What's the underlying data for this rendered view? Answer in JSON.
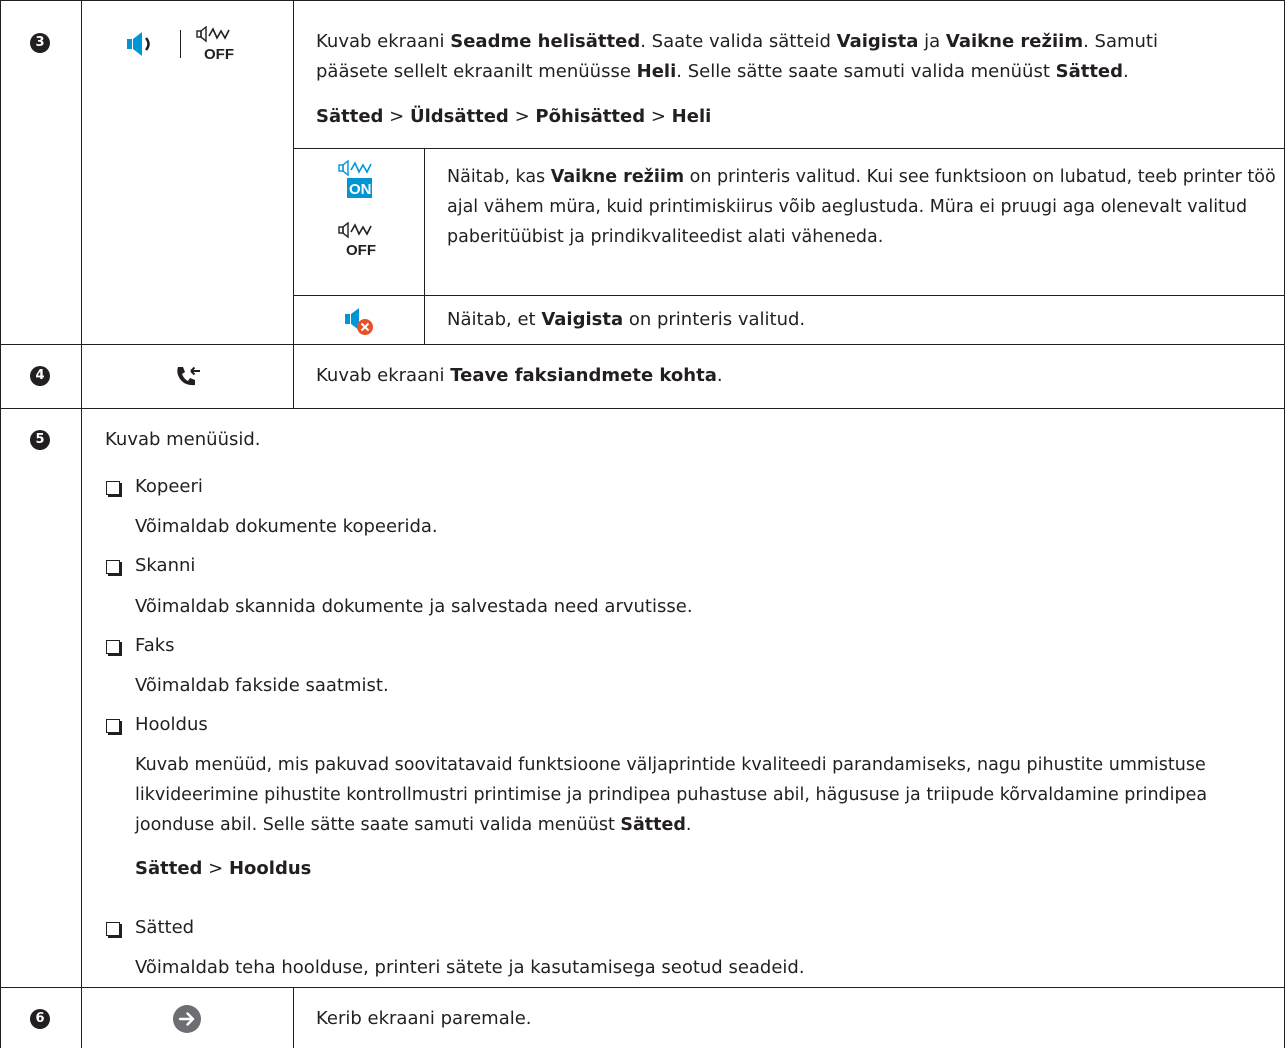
{
  "row3": {
    "num": "3",
    "desc_p1": "Kuvab ekraani ",
    "desc_b1": "Seadme helisätted",
    "desc_p2": ". Saate valida sätteid ",
    "desc_b2": "Vaigista",
    "desc_p3": " ja ",
    "desc_b3": "Vaikne režiim",
    "desc_p4": ". Samuti",
    "desc_l2_p1": "pääsete sellelt ekraanilt menüüsse ",
    "desc_l2_b1": "Heli",
    "desc_l2_p2": ". Selle sätte saate samuti valida menüüst ",
    "desc_l2_b2": "Sätted",
    "desc_l2_p3": ".",
    "path": [
      "Sätted",
      "Üldsätted",
      "Põhisätted",
      "Heli"
    ],
    "path_sep": ">",
    "sub1": {
      "p1": "Näitab, kas ",
      "b1": "Vaikne režiim",
      "p2": " on printeris valitud. Kui see funktsioon on lubatud, teeb printer töö ajal vähem müra, kuid printimiskiirus võib aeglustuda. Müra ei pruugi aga olenevalt valitud paberitüübist ja prindikvaliteedist alati väheneda.",
      "icon_on": "ON",
      "icon_off": "OFF"
    },
    "sub2": {
      "p1": "Näitab, et ",
      "b1": "Vaigista",
      "p2": " on printeris valitud."
    },
    "icon_off_label": "OFF"
  },
  "row4": {
    "num": "4",
    "p1": "Kuvab ekraani ",
    "b1": "Teave faksiandmete kohta",
    "p2": "."
  },
  "row5": {
    "num": "5",
    "intro": "Kuvab menüüsid.",
    "items": [
      {
        "label": "Kopeeri",
        "desc": "Võimaldab dokumente kopeerida."
      },
      {
        "label": "Skanni",
        "desc": "Võimaldab skannida dokumente ja salvestada need arvutisse."
      },
      {
        "label": "Faks",
        "desc": "Võimaldab fakside saatmist."
      },
      {
        "label": "Hooldus",
        "desc": "Kuvab menüüd, mis pakuvad soovitatavaid funktsioone väljaprintide kvaliteedi parandamiseks, nagu pihustite ummistuse likvideerimine pihustite kontrollmustri printimise ja prindipea puhastuse abil, hägususe ja triipude kõrvaldamine prindipea joonduse abil. Selle sätte saate samuti valida menüüst ",
        "desc_b": "Sätted",
        "desc_end": ".",
        "path": [
          "Sätted",
          "Hooldus"
        ],
        "path_sep": ">"
      },
      {
        "label": "Sätted",
        "desc": "Võimaldab teha hoolduse, printeri sätete ja kasutamisega seotud seadeid."
      }
    ]
  },
  "row6": {
    "num": "6",
    "text": "Kerib ekraani paremale."
  },
  "colors": {
    "line": "#231f20",
    "icon_blue": "#0096d6",
    "mute_red": "#e8502a",
    "arrow_grey": "#6d6e71"
  }
}
